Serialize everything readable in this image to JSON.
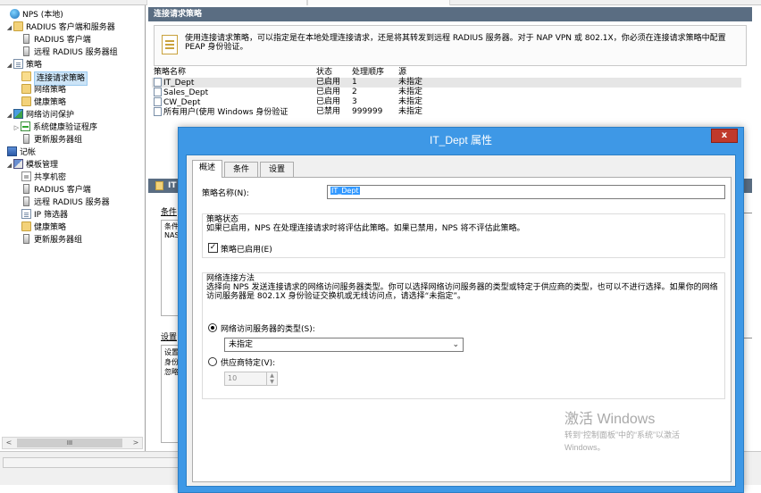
{
  "tree": {
    "items": [
      {
        "label": "NPS (本地)"
      },
      {
        "label": "RADIUS 客户端和服务器"
      },
      {
        "label": "RADIUS 客户端"
      },
      {
        "label": "远程 RADIUS 服务器组"
      },
      {
        "label": "策略"
      },
      {
        "label": "连接请求策略"
      },
      {
        "label": "网络策略"
      },
      {
        "label": "健康策略"
      },
      {
        "label": "网络访问保护"
      },
      {
        "label": "系统健康验证程序"
      },
      {
        "label": "更新服务器组"
      },
      {
        "label": "记帐"
      },
      {
        "label": "模板管理"
      },
      {
        "label": "共享机密"
      },
      {
        "label": "RADIUS 客户端"
      },
      {
        "label": "远程 RADIUS 服务器"
      },
      {
        "label": "IP 筛选器"
      },
      {
        "label": "健康策略"
      },
      {
        "label": "更新服务器组"
      }
    ],
    "scroll_thumb": "III"
  },
  "main": {
    "section_title": "连接请求策略",
    "description": "使用连接请求策略，可以指定是在本地处理连接请求，还是将其转发到远程 RADIUS 服务器。对于 NAP VPN 或 802.1X，你必须在连接请求策略中配置 PEAP 身份验证。",
    "table": {
      "columns": [
        "策略名称",
        "状态",
        "处理顺序",
        "源"
      ],
      "rows": [
        {
          "name": "IT_Dept",
          "status": "已启用",
          "order": "1",
          "source": "未指定"
        },
        {
          "name": "Sales_Dept",
          "status": "已启用",
          "order": "2",
          "source": "未指定"
        },
        {
          "name": "CW_Dept",
          "status": "已启用",
          "order": "3",
          "source": "未指定"
        },
        {
          "name": "所有用户(使用 Windows 身份验证",
          "status": "已禁用",
          "order": "999999",
          "source": "未指定"
        }
      ]
    },
    "detail_title": "IT",
    "conditions_label": "条件",
    "conditions_text": "条件\nNAS",
    "settings_label": "设置",
    "settings_text": "设置\n身份\n忽略"
  },
  "dialog": {
    "title": "IT_Dept 属性",
    "close_label": "x",
    "tabs": [
      "概述",
      "条件",
      "设置"
    ],
    "policy_name_label": "策略名称(N):",
    "policy_name_value": "IT_Dept",
    "policy_state_title": "策略状态",
    "policy_state_note": "如果已启用，NPS 在处理连接请求时将评估此策略。如果已禁用，NPS 将不评估此策略。",
    "policy_enabled_label": "策略已启用(E)",
    "policy_enabled_checked": true,
    "network_method_title": "网络连接方法",
    "network_method_note": "选择向 NPS 发送连接请求的网络访问服务器类型。你可以选择网络访问服务器的类型或特定于供应商的类型，也可以不进行选择。如果你的网络访问服务器是 802.1X 身份验证交换机或无线访问点，请选择“未指定”。",
    "radio_server_type_label": "网络访问服务器的类型(S):",
    "server_type_value": "未指定",
    "radio_vendor_label": "供应商特定(V):",
    "vendor_value": "10"
  },
  "watermark": {
    "line1": "激活 Windows",
    "line2": "转到“控制面板”中的“系统”以激活",
    "line3": "Windows。"
  },
  "colors": {
    "header_bar": "#5a6d82",
    "dialog_frame": "#3e98e6",
    "selection": "#cce4f7",
    "close_button": "#c0392b"
  }
}
